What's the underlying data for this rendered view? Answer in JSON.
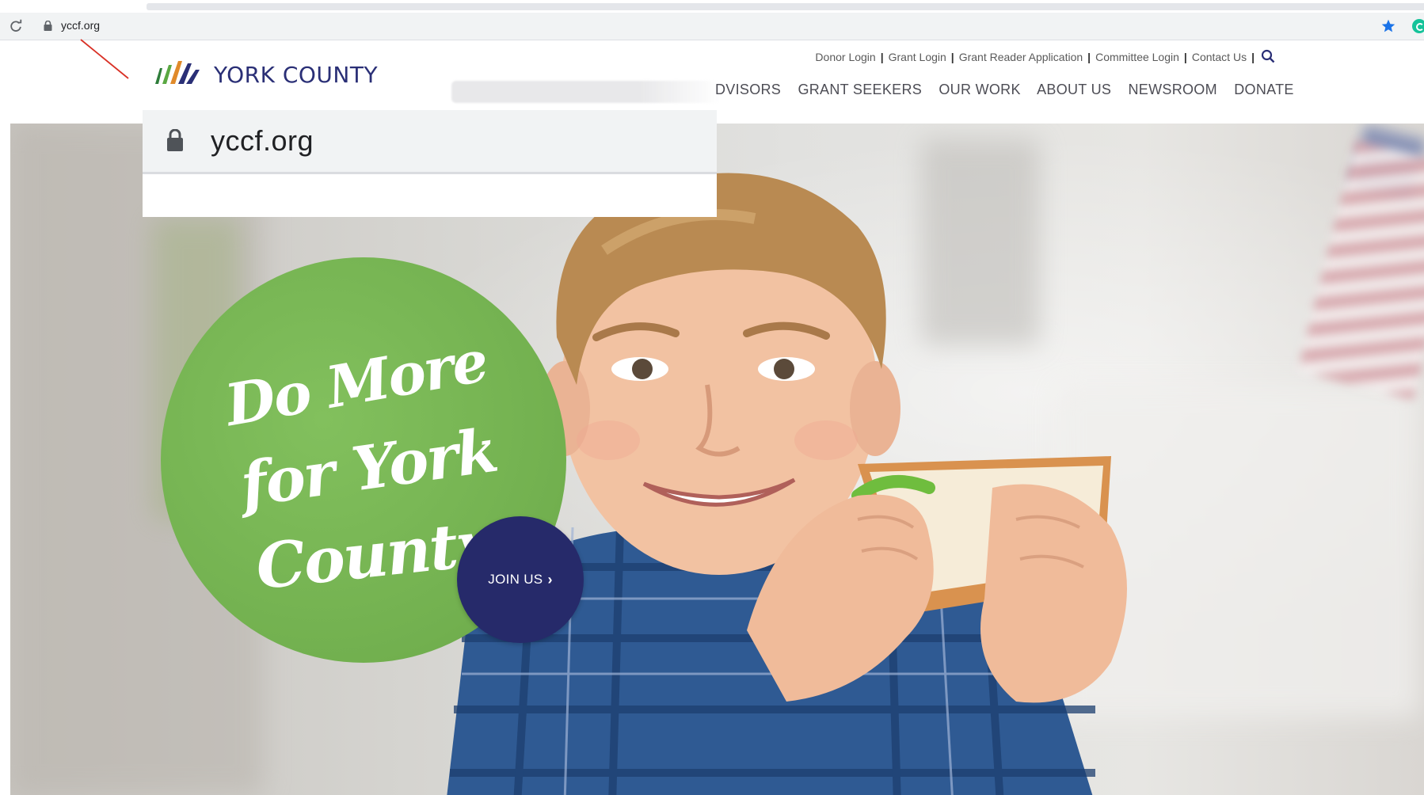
{
  "browser": {
    "url": "yccf.org"
  },
  "site": {
    "logo_text": "YORK COUNTY",
    "utility_nav": [
      "Donor Login",
      "Grant Login",
      "Grant Reader Application",
      "Committee Login",
      "Contact Us"
    ],
    "main_nav": [
      "DVISORS",
      "GRANT SEEKERS",
      "OUR WORK",
      "ABOUT US",
      "NEWSROOM",
      "DONATE"
    ]
  },
  "hero": {
    "slogan_line1": "Do More",
    "slogan_line2": "for York",
    "slogan_line3": "County",
    "join_label": "JOIN US"
  },
  "callout": {
    "url": "yccf.org"
  },
  "colors": {
    "brand_navy": "#262a6a",
    "brand_green": "#72b04f",
    "annotation_red": "#d93025"
  }
}
